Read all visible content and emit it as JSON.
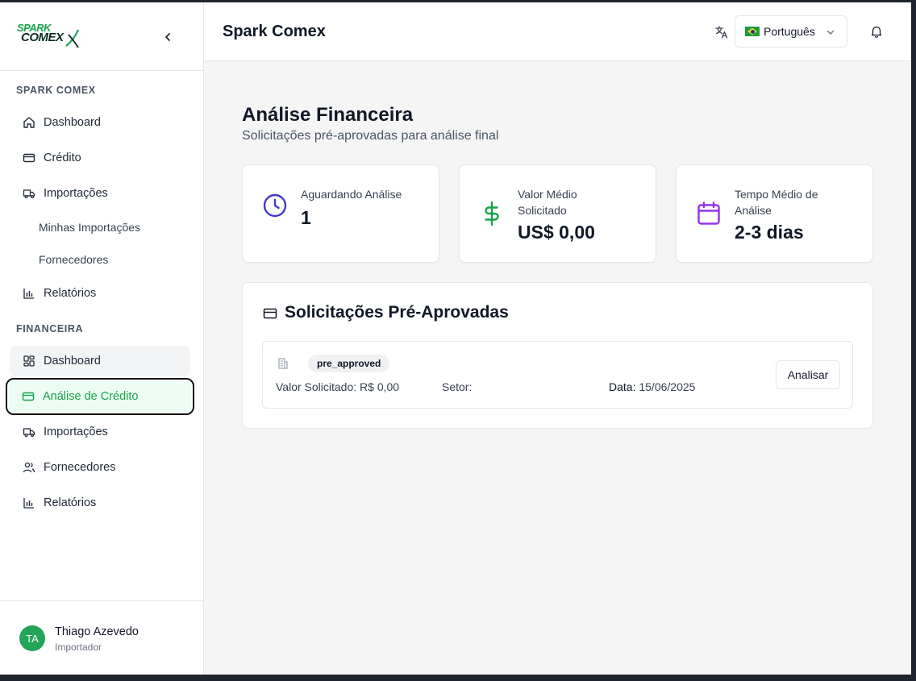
{
  "brand": {
    "logo_line1": "SPARK",
    "logo_line2": "COMEX"
  },
  "sidebar": {
    "section1_label": "SPARK COMEX",
    "section1_items": [
      {
        "label": "Dashboard",
        "icon": "home-icon"
      },
      {
        "label": "Crédito",
        "icon": "credit-card-icon"
      },
      {
        "label": "Importações",
        "icon": "truck-icon"
      },
      {
        "label": "Minhas Importações"
      },
      {
        "label": "Fornecedores"
      },
      {
        "label": "Relatórios",
        "icon": "bar-chart-icon"
      }
    ],
    "section2_label": "FINANCEIRA",
    "section2_items": [
      {
        "label": "Dashboard",
        "icon": "grid-icon"
      },
      {
        "label": "Análise de Crédito",
        "icon": "credit-card-icon"
      },
      {
        "label": "Importações",
        "icon": "truck-icon"
      },
      {
        "label": "Fornecedores",
        "icon": "users-icon"
      },
      {
        "label": "Relatórios",
        "icon": "bar-chart-icon"
      }
    ],
    "user": {
      "initials": "TA",
      "name": "Thiago Azevedo",
      "role": "Importador"
    }
  },
  "header": {
    "title": "Spark Comex",
    "language": "Português"
  },
  "main": {
    "title": "Análise Financeira",
    "subtitle": "Solicitações pré-aprovadas para análise final",
    "stats": [
      {
        "label": "Aguardando Análise",
        "value": "1",
        "icon": "clock-icon",
        "color": "#4338ca"
      },
      {
        "label": "Valor Médio Solicitado",
        "value": "US$ 0,00",
        "icon": "dollar-icon",
        "color": "#16a34a"
      },
      {
        "label": "Tempo Médio de Análise",
        "value": "2-3 dias",
        "icon": "calendar-icon",
        "color": "#9333ea"
      }
    ],
    "panel": {
      "title": "Solicitações Pré-Aprovadas",
      "request": {
        "status": "pre_approved",
        "amount_label": "Valor Solicitado:",
        "amount_value": "R$ 0,00",
        "sector_label": "Setor:",
        "sector_value": "",
        "date_label": "Data:",
        "date_value": "15/06/2025",
        "action_label": "Analisar"
      }
    }
  }
}
